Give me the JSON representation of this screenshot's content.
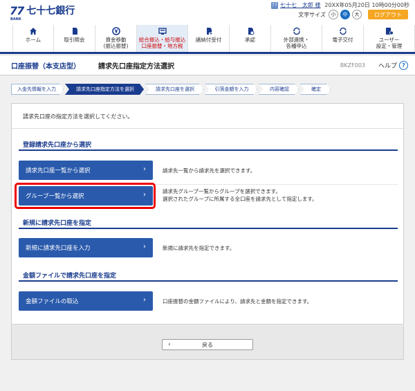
{
  "header": {
    "logo_mark": "77",
    "logo_sub": "BANK",
    "logo_name": "七十七銀行",
    "user_badge": "77",
    "user_name": "七十七　太郎 様",
    "login_time": "20XX年05月20日 10時00分00秒",
    "font_size_label": "文字サイズ",
    "font_sizes": [
      "小",
      "中",
      "大"
    ],
    "logout_label": "ログアウト"
  },
  "nav": {
    "items": [
      {
        "label": "ホーム"
      },
      {
        "label": "取引照会"
      },
      {
        "label": "資金移動\n(振込振替)"
      },
      {
        "label": "総合振込・給与振込\n口座振替・地方税"
      },
      {
        "label": "諸納付受付"
      },
      {
        "label": "承認"
      },
      {
        "label": "外部連携・\n各種申込"
      },
      {
        "label": "電子交付"
      },
      {
        "label": "ユーザー\n設定・管理"
      }
    ]
  },
  "page": {
    "section": "口座振替（本支店型）",
    "title": "請求先口座指定方法選択",
    "code": "BKZF003",
    "help_label": "ヘルプ",
    "help_icon": "?"
  },
  "steps": [
    "入金先情報を入力",
    "請求先口座指定方法を選択",
    "請求先口座を選択",
    "引落金額を入力",
    "内容確認",
    "確定"
  ],
  "main": {
    "intro": "請求先口座の指定方法を選択してください。",
    "sections": [
      {
        "title": "登録請求先口座から選択",
        "options": [
          {
            "label": "請求先口座一覧から選択",
            "desc": [
              "請求先一覧から請求先を選択できます。"
            ]
          },
          {
            "label": "グループ一覧から選択",
            "desc": [
              "請求先グループ一覧からグループを選択できます。",
              "選択されたグループに所属する全口座を請求先として指定します。"
            ]
          }
        ]
      },
      {
        "title": "新規に請求先口座を指定",
        "options": [
          {
            "label": "新規に請求先口座を入力",
            "desc": [
              "新規に請求先を指定できます。"
            ]
          }
        ]
      },
      {
        "title": "金額ファイルで請求先口座を指定",
        "options": [
          {
            "label": "金額ファイルの取込",
            "desc": [
              "口座振替の金額ファイルにより、請求先と金額を指定できます。"
            ]
          }
        ]
      }
    ],
    "back_label": "戻る"
  }
}
